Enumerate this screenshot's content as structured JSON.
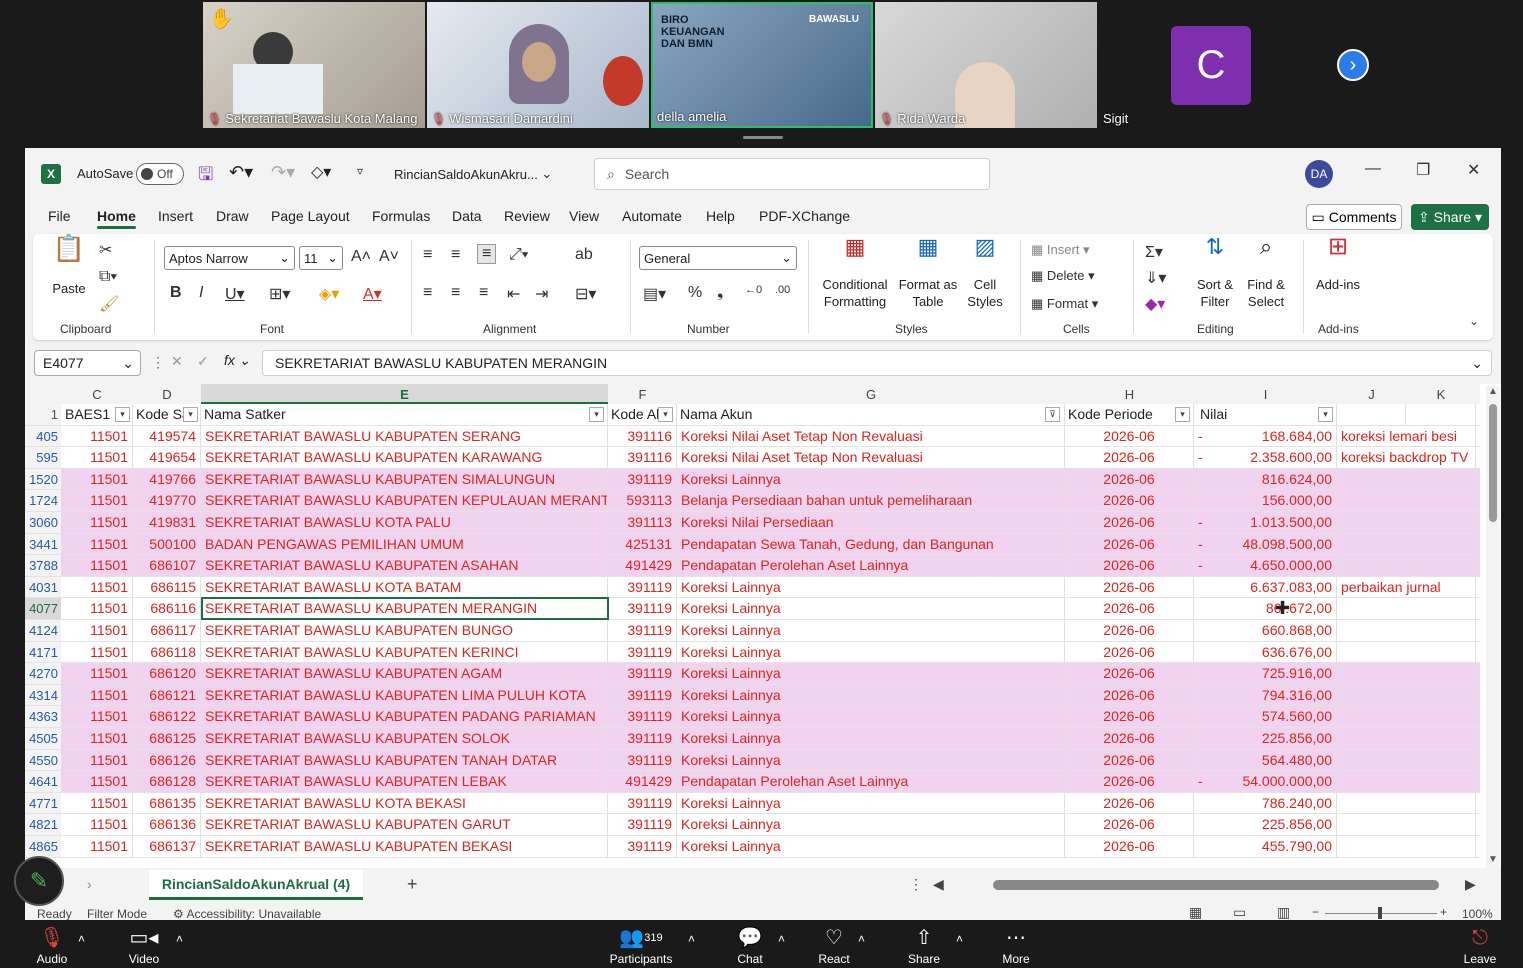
{
  "participants": [
    {
      "name": "Sekretariat Bawaslu Kota Malang",
      "muted": true,
      "bg": "#b8b2a6"
    },
    {
      "name": "Wismasari Damardini",
      "muted": true,
      "bg": "#c9ced6"
    },
    {
      "name": "della amelia",
      "muted": false,
      "bg": "#5d7fa0"
    },
    {
      "name": "Rida Warda",
      "muted": true,
      "bg": "#c8c8c8"
    },
    {
      "name": "Sigit",
      "muted": false,
      "bg": "#1a1a1a"
    }
  ],
  "slide_text": "BIRO KEUANGAN DAN BMN",
  "slide_brand": "BAWASLU",
  "avatar_letter": "C",
  "excel": {
    "autosave_label": "AutoSave",
    "autosave_state": "Off",
    "filename": "RincianSaldoAkunAkru...",
    "search_placeholder": "Search",
    "user_initials": "DA",
    "menu": [
      "File",
      "Home",
      "Insert",
      "Draw",
      "Page Layout",
      "Formulas",
      "Data",
      "Review",
      "View",
      "Automate",
      "Help",
      "PDF-XChange"
    ],
    "comments_label": "Comments",
    "share_label": "Share",
    "ribbon": {
      "paste": "Paste",
      "clipboard": "Clipboard",
      "font_name": "Aptos Narrow",
      "font_size": "11",
      "font": "Font",
      "alignment": "Alignment",
      "number_format": "General",
      "number": "Number",
      "conditional": "Conditional Formatting",
      "format_table": "Format as Table",
      "cell_styles": "Cell Styles",
      "styles": "Styles",
      "insert": "Insert",
      "delete": "Delete",
      "format": "Format",
      "cells": "Cells",
      "sort_filter": "Sort & Filter",
      "find_select": "Find & Select",
      "editing": "Editing",
      "addins": "Add-ins",
      "addins_group": "Add-ins"
    },
    "name_box": "E4077",
    "formula": "SEKRETARIAT BAWASLU KABUPATEN MERANGIN",
    "columns": [
      "C",
      "D",
      "E",
      "F",
      "G",
      "H",
      "I",
      "J",
      "K"
    ],
    "headers": [
      "BAES1",
      "Kode Sa",
      "Nama Satker",
      "Kode Al",
      "Nama Akun",
      "Kode Periode",
      "Nilai",
      "",
      ""
    ],
    "header_row_num": "1",
    "rows": [
      {
        "n": "405",
        "c": "11501",
        "d": "419574",
        "e": "SEKRETARIAT BAWASLU KABUPATEN SERANG",
        "f": "391116",
        "g": "Koreksi Nilai Aset Tetap Non Revaluasi",
        "h": "2026-06",
        "neg": "-",
        "i": "168.684,00",
        "j": "koreksi lemari besi",
        "pink": false
      },
      {
        "n": "595",
        "c": "11501",
        "d": "419654",
        "e": "SEKRETARIAT BAWASLU KABUPATEN KARAWANG",
        "f": "391116",
        "g": "Koreksi Nilai Aset Tetap Non Revaluasi",
        "h": "2026-06",
        "neg": "-",
        "i": "2.358.600,00",
        "j": "koreksi backdrop TV",
        "pink": false
      },
      {
        "n": "1520",
        "c": "11501",
        "d": "419766",
        "e": "SEKRETARIAT BAWASLU KABUPATEN SIMALUNGUN",
        "f": "391119",
        "g": "Koreksi Lainnya",
        "h": "2026-06",
        "neg": "",
        "i": "816.624,00",
        "j": "",
        "pink": true
      },
      {
        "n": "1724",
        "c": "11501",
        "d": "419770",
        "e": "SEKRETARIAT BAWASLU KABUPATEN KEPULAUAN MERANTI",
        "f": "593113",
        "g": "Belanja Persediaan bahan untuk pemeliharaan",
        "h": "2026-06",
        "neg": "",
        "i": "156.000,00",
        "j": "",
        "pink": true
      },
      {
        "n": "3060",
        "c": "11501",
        "d": "419831",
        "e": "SEKRETARIAT BAWASLU KOTA PALU",
        "f": "391113",
        "g": "Koreksi Nilai Persediaan",
        "h": "2026-06",
        "neg": "-",
        "i": "1.013.500,00",
        "j": "",
        "pink": true
      },
      {
        "n": "3441",
        "c": "11501",
        "d": "500100",
        "e": "BADAN PENGAWAS PEMILIHAN UMUM",
        "f": "425131",
        "g": "Pendapatan Sewa Tanah, Gedung, dan Bangunan",
        "h": "2026-06",
        "neg": "-",
        "i": "48.098.500,00",
        "j": "",
        "pink": true
      },
      {
        "n": "3788",
        "c": "11501",
        "d": "686107",
        "e": "SEKRETARIAT BAWASLU KABUPATEN ASAHAN",
        "f": "491429",
        "g": "Pendapatan Perolehan Aset Lainnya",
        "h": "2026-06",
        "neg": "-",
        "i": "4.650.000,00",
        "j": "",
        "pink": true
      },
      {
        "n": "4031",
        "c": "11501",
        "d": "686115",
        "e": "SEKRETARIAT BAWASLU KOTA BATAM",
        "f": "391119",
        "g": "Koreksi Lainnya",
        "h": "2026-06",
        "neg": "",
        "i": "6.637.083,00",
        "j": "perbaikan jurnal",
        "pink": false
      },
      {
        "n": "4077",
        "c": "11501",
        "d": "686116",
        "e": "SEKRETARIAT BAWASLU KABUPATEN MERANGIN",
        "f": "391119",
        "g": "Koreksi Lainnya",
        "h": "2026-06",
        "neg": "",
        "i": "86 .672,00",
        "j": "",
        "pink": false
      },
      {
        "n": "4124",
        "c": "11501",
        "d": "686117",
        "e": "SEKRETARIAT BAWASLU KABUPATEN BUNGO",
        "f": "391119",
        "g": "Koreksi Lainnya",
        "h": "2026-06",
        "neg": "",
        "i": "660.868,00",
        "j": "",
        "pink": false
      },
      {
        "n": "4171",
        "c": "11501",
        "d": "686118",
        "e": "SEKRETARIAT BAWASLU KABUPATEN KERINCI",
        "f": "391119",
        "g": "Koreksi Lainnya",
        "h": "2026-06",
        "neg": "",
        "i": "636.676,00",
        "j": "",
        "pink": false
      },
      {
        "n": "4270",
        "c": "11501",
        "d": "686120",
        "e": "SEKRETARIAT BAWASLU KABUPATEN AGAM",
        "f": "391119",
        "g": "Koreksi Lainnya",
        "h": "2026-06",
        "neg": "",
        "i": "725.916,00",
        "j": "",
        "pink": true
      },
      {
        "n": "4314",
        "c": "11501",
        "d": "686121",
        "e": "SEKRETARIAT BAWASLU KABUPATEN LIMA PULUH KOTA",
        "f": "391119",
        "g": "Koreksi Lainnya",
        "h": "2026-06",
        "neg": "",
        "i": "794.316,00",
        "j": "",
        "pink": true
      },
      {
        "n": "4363",
        "c": "11501",
        "d": "686122",
        "e": "SEKRETARIAT BAWASLU KABUPATEN PADANG PARIAMAN",
        "f": "391119",
        "g": "Koreksi Lainnya",
        "h": "2026-06",
        "neg": "",
        "i": "574.560,00",
        "j": "",
        "pink": true
      },
      {
        "n": "4505",
        "c": "11501",
        "d": "686125",
        "e": "SEKRETARIAT BAWASLU KABUPATEN SOLOK",
        "f": "391119",
        "g": "Koreksi Lainnya",
        "h": "2026-06",
        "neg": "",
        "i": "225.856,00",
        "j": "",
        "pink": true
      },
      {
        "n": "4550",
        "c": "11501",
        "d": "686126",
        "e": "SEKRETARIAT BAWASLU KABUPATEN TANAH DATAR",
        "f": "391119",
        "g": "Koreksi Lainnya",
        "h": "2026-06",
        "neg": "",
        "i": "564.480,00",
        "j": "",
        "pink": true
      },
      {
        "n": "4641",
        "c": "11501",
        "d": "686128",
        "e": "SEKRETARIAT BAWASLU KABUPATEN LEBAK",
        "f": "491429",
        "g": "Pendapatan Perolehan Aset Lainnya",
        "h": "2026-06",
        "neg": "-",
        "i": "54.000.000,00",
        "j": "",
        "pink": true
      },
      {
        "n": "4771",
        "c": "11501",
        "d": "686135",
        "e": "SEKRETARIAT BAWASLU KOTA BEKASI",
        "f": "391119",
        "g": "Koreksi Lainnya",
        "h": "2026-06",
        "neg": "",
        "i": "786.240,00",
        "j": "",
        "pink": false
      },
      {
        "n": "4821",
        "c": "11501",
        "d": "686136",
        "e": "SEKRETARIAT BAWASLU KABUPATEN GARUT",
        "f": "391119",
        "g": "Koreksi Lainnya",
        "h": "2026-06",
        "neg": "",
        "i": "225.856,00",
        "j": "",
        "pink": false
      },
      {
        "n": "4865",
        "c": "11501",
        "d": "686137",
        "e": "SEKRETARIAT BAWASLU KABUPATEN BEKASI",
        "f": "391119",
        "g": "Koreksi Lainnya",
        "h": "2026-06",
        "neg": "",
        "i": "455.790,00",
        "j": "",
        "pink": false
      }
    ],
    "sheet_tab": "RincianSaldoAkunAkrual (4)",
    "status_ready": "Ready",
    "status_filter": "Filter Mode",
    "status_access": "Accessibility: Unavailable",
    "zoom": "100%"
  },
  "zoom_bar": {
    "audio": "Audio",
    "video": "Video",
    "participants": "Participants",
    "participant_count": "319",
    "chat": "Chat",
    "react": "React",
    "share": "Share",
    "more": "More",
    "leave": "Leave"
  }
}
